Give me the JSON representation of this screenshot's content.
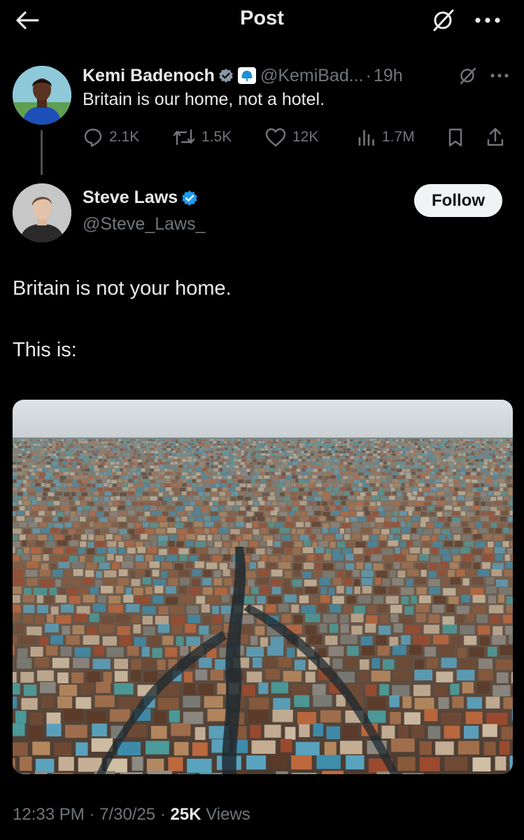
{
  "topbar": {
    "title": "Post"
  },
  "quoted": {
    "name": "Kemi Badenoch",
    "handle": "@KemiBad...",
    "age": "19h",
    "text": "Britain is our home, not a hotel.",
    "stats": {
      "replies": "2.1K",
      "reposts": "1.5K",
      "likes": "12K",
      "views": "1.7M"
    }
  },
  "post": {
    "name": "Steve Laws",
    "handle": "@Steve_Laws_",
    "follow_label": "Follow",
    "line1": "Britain is not your home.",
    "line2": "This is:",
    "time": "12:33 PM",
    "date": "7/30/25",
    "views_count": "25K",
    "views_label": "Views"
  },
  "colors": {
    "background": "#000000",
    "text": "#e7e9ea",
    "muted": "#71767b",
    "verified": "#1d9bf0"
  },
  "icons": [
    "back-arrow-icon",
    "grok-icon",
    "more-icon",
    "verified-badge-icon",
    "org-badge-icon",
    "reply-icon",
    "repost-icon",
    "like-icon",
    "views-icon",
    "bookmark-icon",
    "share-icon"
  ]
}
